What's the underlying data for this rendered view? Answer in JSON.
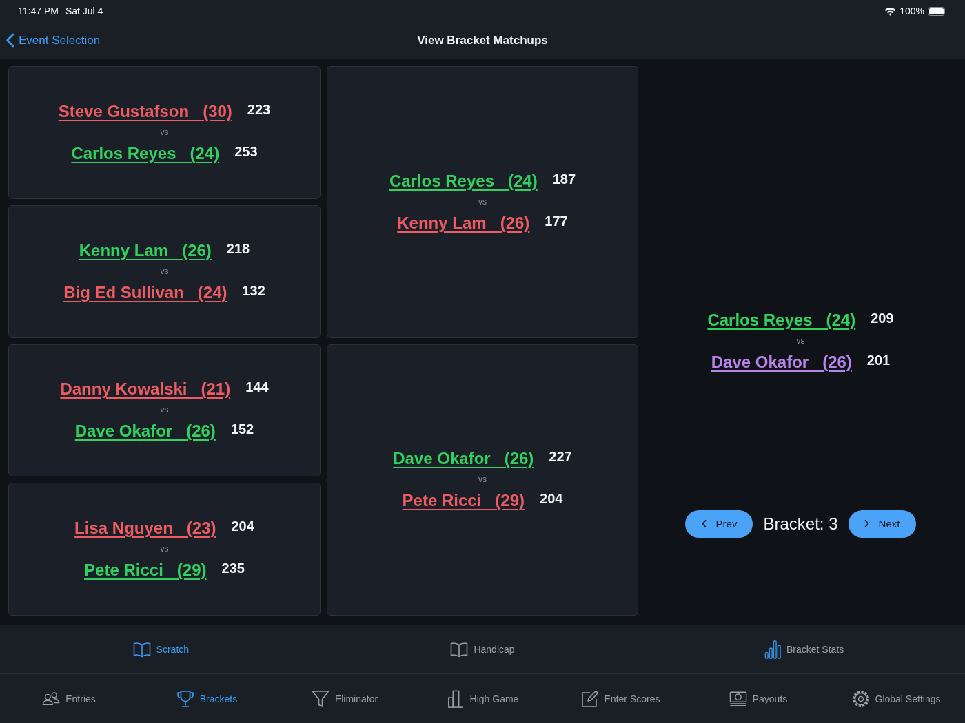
{
  "status_bar": {
    "time": "11:47 PM",
    "date": "Sat Jul 4",
    "battery": "100%"
  },
  "nav_bar": {
    "back_label": "Event Selection",
    "title": "View Bracket Matchups"
  },
  "rounds": [
    {
      "matches": [
        {
          "players": [
            {
              "name": "Steve Gustafson   (30)",
              "score": "223",
              "color": "#ee5b63"
            },
            {
              "name": "Carlos Reyes   (24)",
              "score": "253",
              "color": "#30d15f"
            }
          ],
          "separator": "vs"
        },
        {
          "players": [
            {
              "name": "Kenny Lam   (26)",
              "score": "218",
              "color": "#30d15f"
            },
            {
              "name": "Big Ed Sullivan   (24)",
              "score": "132",
              "color": "#ee5b63"
            }
          ],
          "separator": "vs"
        },
        {
          "players": [
            {
              "name": "Danny Kowalski   (21)",
              "score": "144",
              "color": "#ee5b63"
            },
            {
              "name": "Dave Okafor   (26)",
              "score": "152",
              "color": "#30d15f"
            }
          ],
          "separator": "vs"
        },
        {
          "players": [
            {
              "name": "Lisa Nguyen   (23)",
              "score": "204",
              "color": "#ee5b63"
            },
            {
              "name": "Pete Ricci   (29)",
              "score": "235",
              "color": "#30d15f"
            }
          ],
          "separator": "vs"
        }
      ]
    },
    {
      "matches": [
        {
          "players": [
            {
              "name": "Carlos Reyes   (24)",
              "score": "187",
              "color": "#30d15f"
            },
            {
              "name": "Kenny Lam   (26)",
              "score": "177",
              "color": "#ee5b63"
            }
          ],
          "separator": "vs"
        },
        {
          "players": [
            {
              "name": "Dave Okafor   (26)",
              "score": "227",
              "color": "#30d15f"
            },
            {
              "name": "Pete Ricci   (29)",
              "score": "204",
              "color": "#ee5b63"
            }
          ],
          "separator": "vs"
        }
      ]
    }
  ],
  "final": {
    "players": [
      {
        "name": "Carlos Reyes   (24)",
        "score": "209",
        "color": "#30d15f"
      },
      {
        "name": "Dave Okafor   (26)",
        "score": "201",
        "color": "#b884ec"
      }
    ],
    "separator": "vs"
  },
  "bracket_nav": {
    "prev": "Prev",
    "label": "Bracket: 3",
    "next": "Next"
  },
  "bracket_tabs": [
    {
      "label": "Scratch",
      "selected": true
    },
    {
      "label": "Handicap",
      "selected": false
    },
    {
      "label": "Bracket Stats",
      "selected": false
    }
  ],
  "tab_bar": [
    {
      "label": "Entries",
      "selected": false
    },
    {
      "label": "Brackets",
      "selected": true
    },
    {
      "label": "Eliminator",
      "selected": false
    },
    {
      "label": "High Game",
      "selected": false
    },
    {
      "label": "Enter Scores",
      "selected": false
    },
    {
      "label": "Payouts",
      "selected": false
    },
    {
      "label": "Global Settings",
      "selected": false
    }
  ]
}
